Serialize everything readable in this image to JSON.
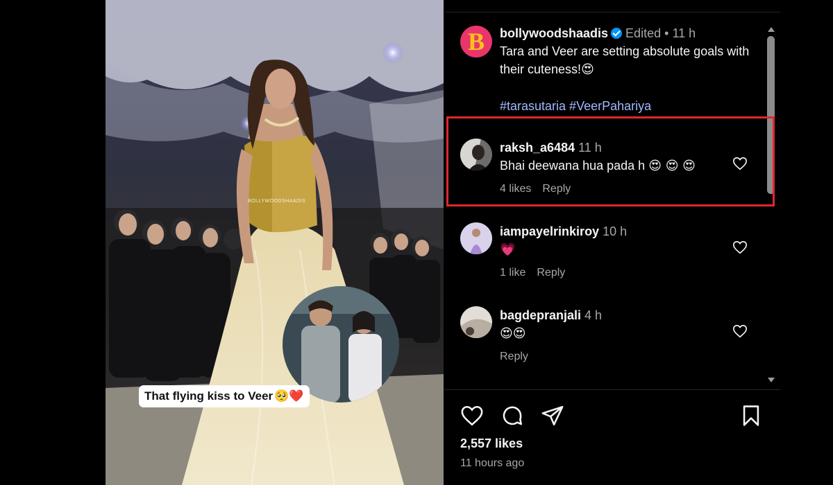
{
  "media": {
    "overlay_caption": "That flying kiss to Veer",
    "overlay_emojis": "🥺❤️",
    "watermark": "BOLLYWOODSHAADIS"
  },
  "post": {
    "brand_initial": "B",
    "username": "bollywoodshaadis",
    "verified": true,
    "edited_label": "Edited",
    "separator": "•",
    "age": "11 h",
    "caption": "Tara and Veer are setting absolute goals with their cuteness!",
    "caption_emoji": "😍",
    "hashtags": "#tarasutaria #VeerPahariya"
  },
  "comments": [
    {
      "username": "raksh_a6484",
      "age": "11 h",
      "text": "Bhai deewana hua pada h",
      "emojis": "😍 😍 😍",
      "likes": "4 likes",
      "reply": "Reply",
      "highlighted": true
    },
    {
      "username": "iampayelrinkiroy",
      "age": "10 h",
      "text": "",
      "emojis": "💗",
      "likes": "1 like",
      "reply": "Reply",
      "highlighted": false
    },
    {
      "username": "bagdepranjali",
      "age": "4 h",
      "text": "",
      "emojis": "😍😍",
      "likes": "",
      "reply": "Reply",
      "highlighted": false
    }
  ],
  "footer": {
    "like_count": "2,557 likes",
    "timestamp": "11 hours ago"
  },
  "icons": [
    "like-heart-icon",
    "comment-icon",
    "share-icon",
    "save-bookmark-icon",
    "comment-like-heart-icon",
    "verified-badge-icon"
  ],
  "colors": {
    "background": "#000000",
    "hashtag": "#a1b9ff",
    "muted_text": "#a8a8a8",
    "verified": "#0095f6",
    "highlight_box": "#e3262c",
    "brand_avatar_bg": "#e8366b",
    "brand_avatar_letter": "#ffc21a"
  }
}
